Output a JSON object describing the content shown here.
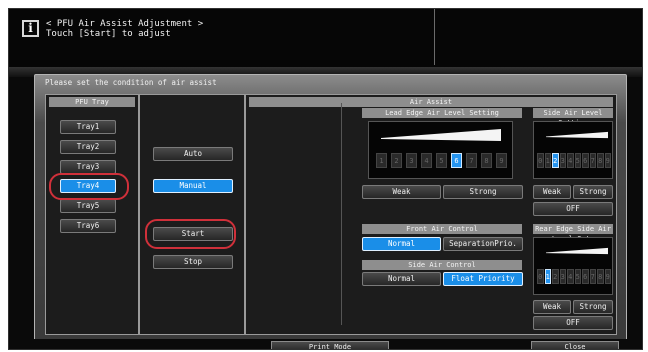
{
  "header": {
    "title": "< PFU Air Assist Adjustment >",
    "subtitle": "Touch [Start] to adjust",
    "info_glyph": "i"
  },
  "panel": {
    "title": "Please set the condition of air assist"
  },
  "pfu_tray": {
    "heading": "PFU Tray",
    "trays": [
      "Tray1",
      "Tray2",
      "Tray3",
      "Tray4",
      "Tray5",
      "Tray6"
    ],
    "selected": "Tray4"
  },
  "mode": {
    "auto": "Auto",
    "manual": "Manual",
    "selected": "Manual",
    "start": "Start",
    "stop": "Stop"
  },
  "air_assist": {
    "heading": "Air Assist",
    "lead_edge": {
      "heading": "Lead Edge Air Level Setting",
      "levels": [
        "1",
        "2",
        "3",
        "4",
        "5",
        "6",
        "7",
        "8",
        "9"
      ],
      "selected": "6",
      "weak": "Weak",
      "strong": "Strong"
    },
    "side_air": {
      "heading": "Side Air Level Setting",
      "levels": [
        "0",
        "1",
        "2",
        "3",
        "4",
        "5",
        "6",
        "7",
        "8",
        "9"
      ],
      "selected": "2",
      "weak": "Weak",
      "strong": "Strong",
      "off": "OFF"
    },
    "front_air": {
      "heading": "Front Air Control",
      "normal": "Normal",
      "separation": "SeparationPrio.",
      "selected": "Normal"
    },
    "side_control": {
      "heading": "Side Air Control",
      "normal": "Normal",
      "float": "Float Priority",
      "selected": "Float Priority"
    },
    "rear_edge": {
      "heading": "Rear Edge Side Air Level Set.",
      "levels": [
        "0",
        "1",
        "2",
        "3",
        "4",
        "5",
        "6",
        "7",
        "8",
        "9"
      ],
      "selected": "1",
      "weak": "Weak",
      "strong": "Strong",
      "off": "OFF"
    }
  },
  "footer": {
    "print_mode": "Print Mode",
    "close": "Close"
  },
  "colors": {
    "accent": "#1a8ee8",
    "highlight_circle": "#d0303a"
  }
}
